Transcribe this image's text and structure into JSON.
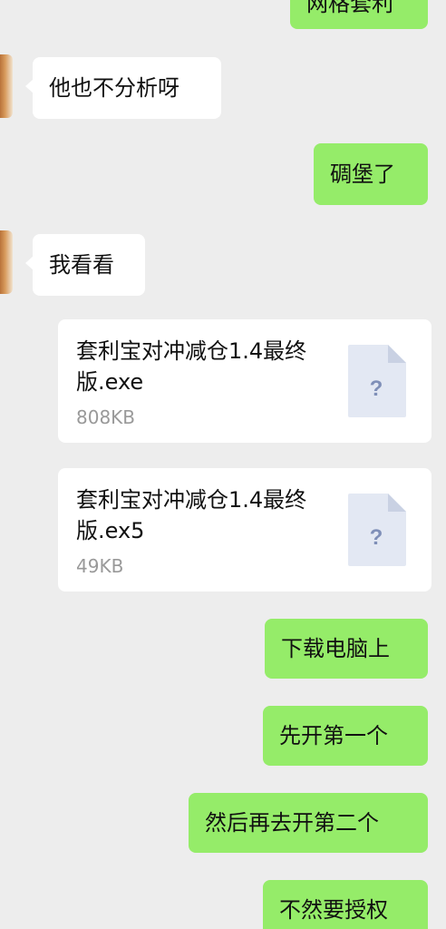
{
  "messages": [
    {
      "side": "out",
      "text": "网格套利"
    },
    {
      "side": "in",
      "text": "他也不分析呀"
    },
    {
      "side": "out",
      "text": "碉堡了"
    },
    {
      "side": "in",
      "text": "我看看"
    },
    {
      "side": "in",
      "type": "file",
      "name": "套利宝对冲减仓1.4最终版.exe",
      "size": "808KB",
      "icon": "unknown-file-icon"
    },
    {
      "side": "in",
      "type": "file",
      "name": "套利宝对冲减仓1.4最终版.ex5",
      "size": "49KB",
      "icon": "unknown-file-icon"
    },
    {
      "side": "out",
      "text": "下载电脑上"
    },
    {
      "side": "out",
      "text": "先开第一个"
    },
    {
      "side": "out",
      "text": "然后再去开第二个"
    },
    {
      "side": "out",
      "text": "不然要授权"
    }
  ],
  "file_icon_glyph": "?",
  "colors": {
    "outgoing": "#95ec69",
    "incoming": "#ffffff",
    "background": "#ededed"
  }
}
